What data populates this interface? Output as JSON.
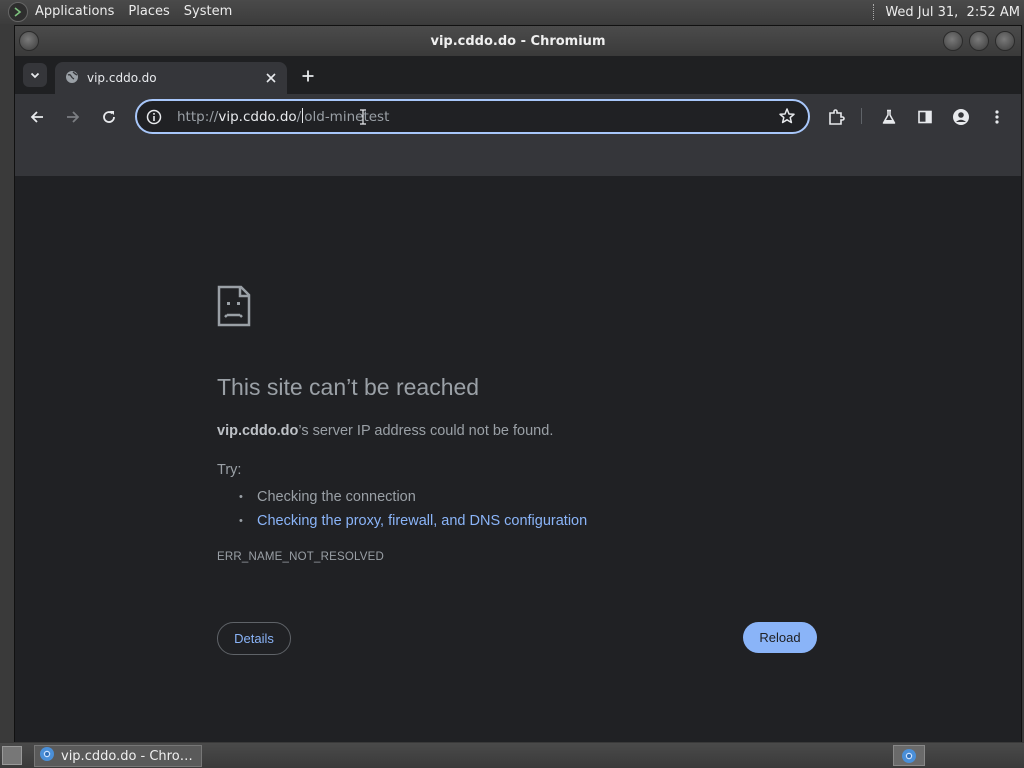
{
  "top_panel": {
    "menus": [
      "Applications",
      "Places",
      "System"
    ],
    "clock": "Wed Jul 31,  2:52 AM"
  },
  "window": {
    "title": "vip.cddo.do - Chromium"
  },
  "tab": {
    "title": "vip.cddo.do"
  },
  "omnibox": {
    "scheme": "http://",
    "host": "vip.cddo.do",
    "path_before_caret": "/",
    "path_after_caret": "old-minetest"
  },
  "error_page": {
    "title": "This site can’t be reached",
    "host_bold": "vip.cddo.do",
    "description_rest": "’s server IP address could not be found.",
    "try_label": "Try:",
    "suggestions": [
      "Checking the connection",
      "Checking the proxy, firewall, and DNS configuration"
    ],
    "error_code": "ERR_NAME_NOT_RESOLVED",
    "details_label": "Details",
    "reload_label": "Reload"
  },
  "taskbar": {
    "task_label": "vip.cddo.do - Chro…"
  },
  "colors": {
    "accent_blue": "#8ab4f8",
    "page_bg": "#202124",
    "toolbar_bg": "#35363a",
    "omnibox_focus": "#a8c7fa"
  },
  "icons": [
    "terminal-logo-icon",
    "globe-icon",
    "close-icon",
    "plus-icon",
    "chevron-down-icon",
    "back-arrow-icon",
    "forward-arrow-icon",
    "reload-icon",
    "info-icon",
    "star-icon",
    "extensions-icon",
    "labs-flask-icon",
    "side-panel-icon",
    "profile-icon",
    "kebab-menu-icon",
    "sad-page-icon",
    "chromium-icon"
  ]
}
